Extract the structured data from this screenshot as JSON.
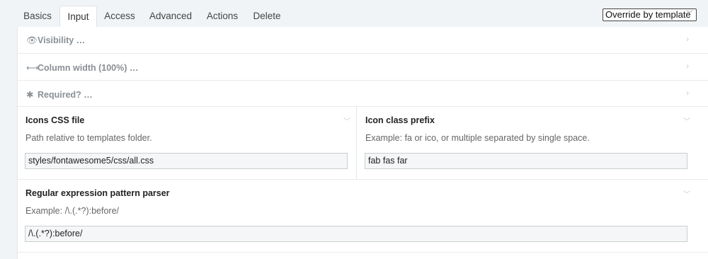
{
  "tabs": [
    {
      "label": "Basics",
      "active": false
    },
    {
      "label": "Input",
      "active": true
    },
    {
      "label": "Access",
      "active": false
    },
    {
      "label": "Advanced",
      "active": false
    },
    {
      "label": "Actions",
      "active": false
    },
    {
      "label": "Delete",
      "active": false
    }
  ],
  "override_select": {
    "value": "Override by template"
  },
  "collapsed_rows": [
    {
      "icon": "eye-icon",
      "glyph": "👁",
      "label": "Visibility …"
    },
    {
      "icon": "arrows-horizontal-icon",
      "glyph": "⟷",
      "label": "Column width (100%) …"
    },
    {
      "icon": "asterisk-icon",
      "glyph": "✱",
      "label": "Required? …"
    }
  ],
  "fields": {
    "icons_css": {
      "title": "Icons CSS file",
      "help": "Path relative to templates folder.",
      "value": "styles/fontawesome5/css/all.css"
    },
    "icon_prefix": {
      "title": "Icon class prefix",
      "help": "Example: fa or ico, or multiple separated by single space.",
      "value": "fab fas far"
    },
    "regex": {
      "title": "Regular expression pattern parser",
      "help": "Example: /\\.(.*?):before/",
      "value": "/\\.(.*?):before/"
    }
  }
}
